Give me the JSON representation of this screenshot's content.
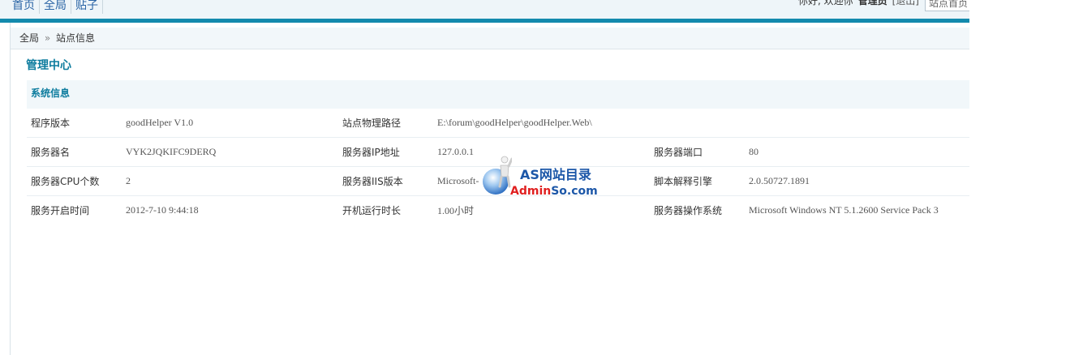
{
  "nav": {
    "items": [
      "首页",
      "全局",
      "贴子"
    ]
  },
  "userbar": {
    "greeting": "你好, 欢迎你",
    "username": "管理员",
    "logout": "[退出]"
  },
  "search": {
    "placeholder": "站点首页"
  },
  "breadcrumb": {
    "root": "全局",
    "separator": "»",
    "current": "站点信息"
  },
  "page": {
    "title": "管理中心"
  },
  "section": {
    "title": "系统信息"
  },
  "info": {
    "rows": [
      [
        {
          "label": "程序版本",
          "value": "goodHelper V1.0"
        },
        {
          "label": "站点物理路径",
          "value": "E:\\forum\\goodHelper\\goodHelper.Web\\"
        },
        {
          "label": "",
          "value": ""
        }
      ],
      [
        {
          "label": "服务器名",
          "value": "VYK2JQKIFC9DERQ"
        },
        {
          "label": "服务器IP地址",
          "value": "127.0.0.1"
        },
        {
          "label": "服务器端口",
          "value": "80"
        }
      ],
      [
        {
          "label": "服务器CPU个数",
          "value": "2"
        },
        {
          "label": "服务器IIS版本",
          "value": "Microsoft-"
        },
        {
          "label": "脚本解释引擎",
          "value": "2.0.50727.1891"
        }
      ],
      [
        {
          "label": "服务开启时间",
          "value": "2012-7-10 9:44:18"
        },
        {
          "label": "开机运行时长",
          "value": "1.00小时"
        },
        {
          "label": "服务器操作系统",
          "value": "Microsoft Windows NT 5.1.2600 Service Pack 3"
        }
      ]
    ]
  },
  "watermark": {
    "line1": "AS网站目录",
    "line2_a": "Admin",
    "line2_b": "So",
    "line2_c": ".com"
  },
  "colors": {
    "accent": "#138aad",
    "title": "#0d7c9e",
    "nav_link": "#2a64a5"
  }
}
